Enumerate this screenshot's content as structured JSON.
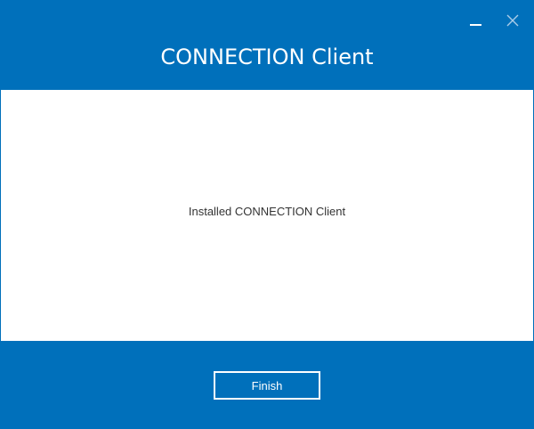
{
  "window": {
    "title": "CONNECTION Client",
    "controls": {
      "minimize_icon": "minimize-icon",
      "close_icon": "close-icon"
    }
  },
  "content": {
    "message": "Installed CONNECTION Client"
  },
  "footer": {
    "finish_label": "Finish"
  },
  "colors": {
    "brand_blue": "#0070BB",
    "content_bg": "#FFFFFF",
    "text_dark": "#333333",
    "text_light": "#FFFFFF"
  }
}
